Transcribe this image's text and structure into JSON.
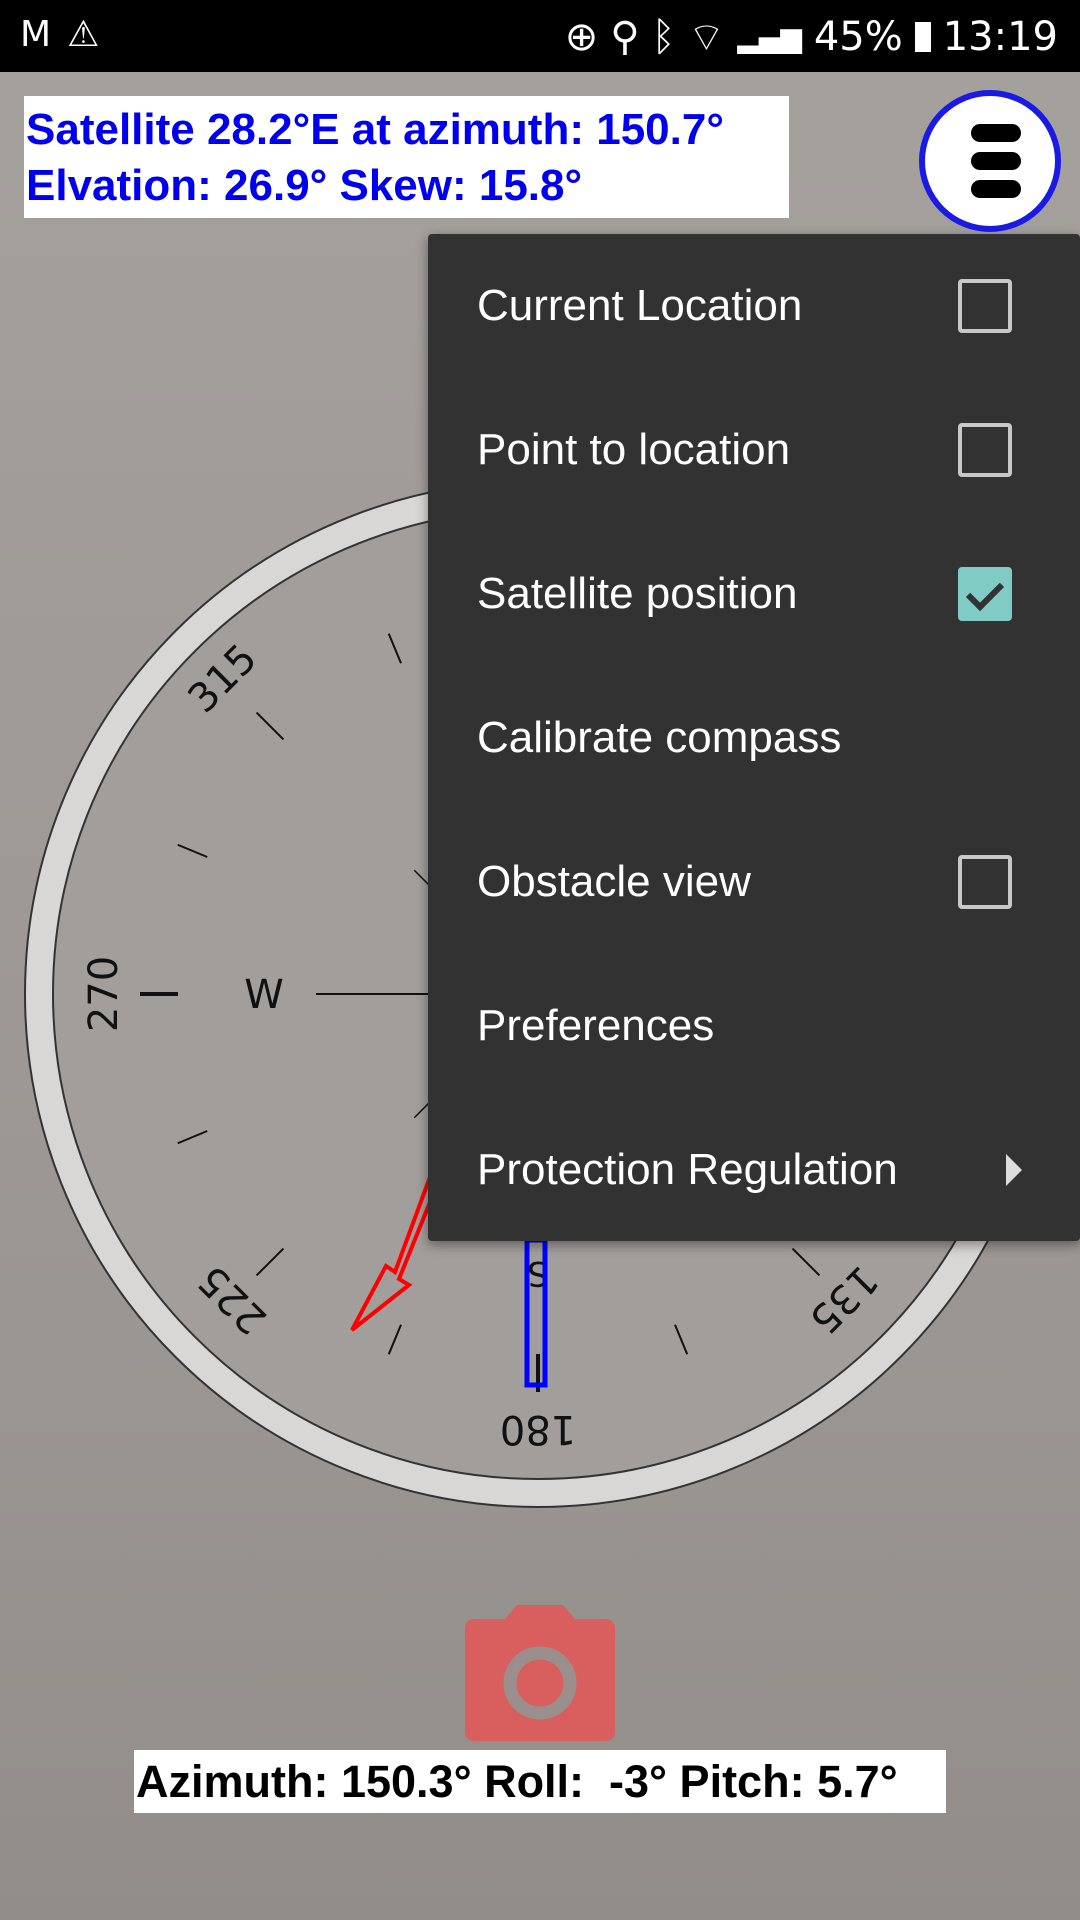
{
  "status_bar": {
    "left_icons": [
      "gmail-icon",
      "warning-icon"
    ],
    "right_icons": [
      "data-saver-icon",
      "location-icon",
      "bluetooth-icon",
      "wifi-icon",
      "signal-icon"
    ],
    "battery": "45%",
    "time": "13:19"
  },
  "satellite_info": {
    "line1": "Satellite 28.2°E at azimuth: 150.7°",
    "line2": "Elvation: 26.9° Skew: 15.8°"
  },
  "compass": {
    "labels": {
      "l315": "315",
      "l270": "270",
      "l225": "225",
      "l180": "180",
      "l135": "135",
      "west": "W",
      "south": "S"
    },
    "satellite_azimuth_marker_color": "#0000ff",
    "direction_arrow_color": "#ff0000"
  },
  "menu": {
    "items": [
      {
        "label": "Current Location",
        "checkbox": true,
        "checked": false
      },
      {
        "label": "Point to location",
        "checkbox": true,
        "checked": false
      },
      {
        "label": "Satellite position",
        "checkbox": true,
        "checked": true
      },
      {
        "label": "Calibrate compass"
      },
      {
        "label": "Obstacle view",
        "checkbox": true,
        "checked": false
      },
      {
        "label": "Preferences"
      },
      {
        "label": "Protection Regulation",
        "submenu": true
      }
    ]
  },
  "bottom_readout": "Azimuth: 150.3° Roll:  -3° Pitch: 5.7°",
  "colors": {
    "info_text": "#0000ee",
    "menu_bg": "#323232",
    "checkbox_checked": "#80cbc4",
    "camera_button": "#e05a5a"
  }
}
